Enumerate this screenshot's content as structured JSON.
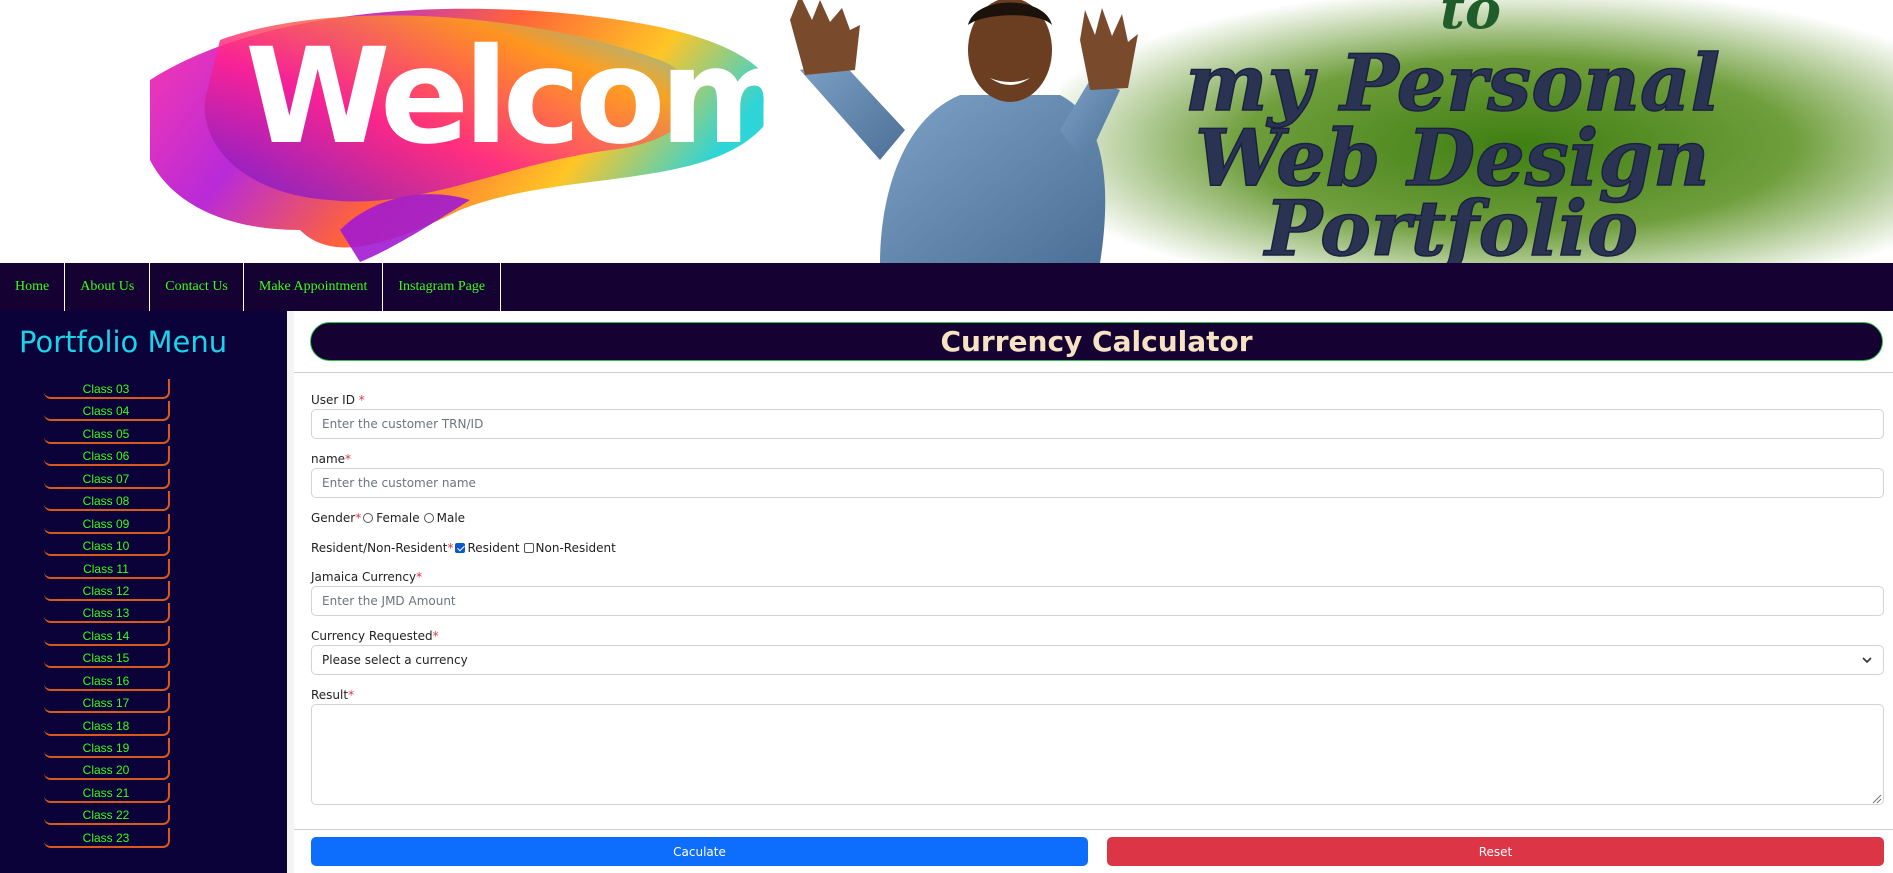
{
  "banner": {
    "welcome": "Welcome",
    "to": "to",
    "line1": "my Personal",
    "line2": "Web Design",
    "line3": "Portfolio"
  },
  "nav": {
    "items": [
      "Home",
      "About Us",
      "Contact Us",
      "Make Appointment",
      "Instagram Page"
    ]
  },
  "sidebar": {
    "title": "Portfolio Menu",
    "items": [
      "Class 03",
      "Class 04",
      "Class 05",
      "Class 06",
      "Class 07",
      "Class 08",
      "Class 09",
      "Class 10",
      "Class 11",
      "Class 12",
      "Class 13",
      "Class 14",
      "Class 15",
      "Class 16",
      "Class 17",
      "Class 18",
      "Class 19",
      "Class 20",
      "Class 21",
      "Class 22",
      "Class 23"
    ]
  },
  "form": {
    "title": "Currency Calculator",
    "user_id": {
      "label": "User ID ",
      "required": "*",
      "placeholder": "Enter the customer TRN/ID"
    },
    "name": {
      "label": "name",
      "required": "*",
      "placeholder": "Enter the customer name"
    },
    "gender": {
      "label": "Gender",
      "required": "*",
      "options": [
        "Female",
        "Male"
      ],
      "selected": ""
    },
    "residency": {
      "label": "Resident/Non-Resident",
      "required": "*",
      "options": [
        "Resident",
        "Non-Resident"
      ],
      "checked": [
        "Resident"
      ]
    },
    "jmd": {
      "label": "Jamaica Currency",
      "required": "*",
      "placeholder": "Enter the JMD Amount"
    },
    "currency": {
      "label": "Currency Requested",
      "required": "*",
      "selected": "Please select a currency"
    },
    "result": {
      "label": "Result",
      "required": "*",
      "value": ""
    },
    "calculate_label": "Caculate",
    "reset_label": "Reset"
  },
  "colors": {
    "nav_bg": "#150232",
    "nav_text": "#39ff14",
    "sidebar_bg": "#0a0238",
    "sidebar_title": "#1bd3e8",
    "title_text": "#f5e3c3",
    "primary": "#0d6efd",
    "danger": "#dc3545"
  }
}
